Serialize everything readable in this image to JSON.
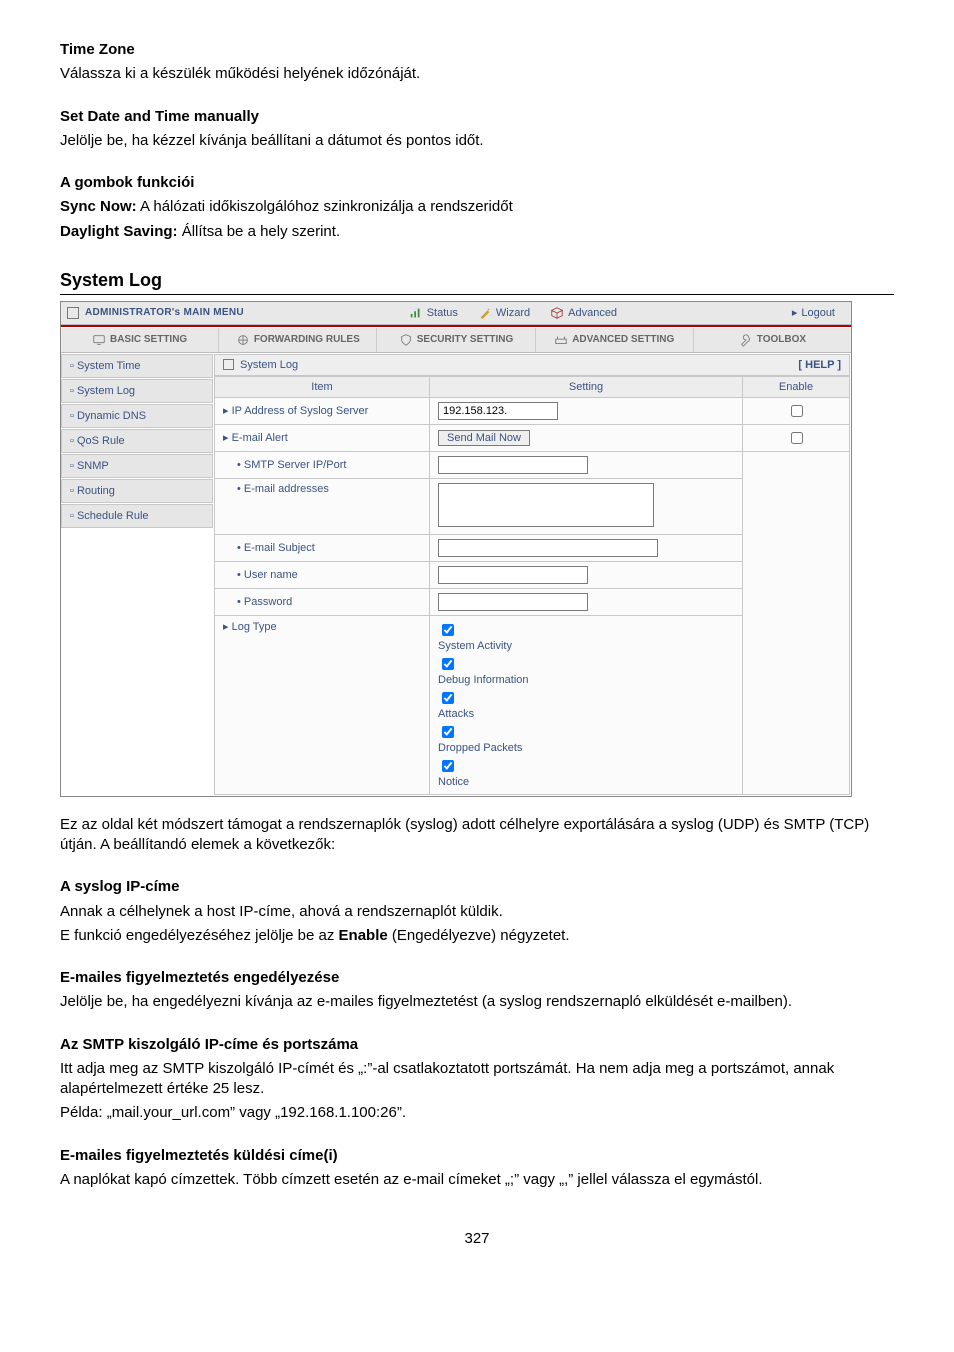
{
  "text": {
    "timezone_h": "Time Zone",
    "timezone_p": "Válassza ki a készülék működési helyének időzónáját.",
    "setdate_h": "Set Date and Time manually",
    "setdate_p": "Jelölje be, ha kézzel kívánja beállítani a dátumot és pontos időt.",
    "buttons_h": "A gombok funkciói",
    "syncnow_b": "Sync Now:",
    "syncnow_t": " A hálózati időkiszolgálóhoz szinkronizálja a rendszeridőt",
    "daylight_b": "Daylight Saving:",
    "daylight_t": " Állítsa be a hely szerint.",
    "syslog_h": "System Log",
    "after1": "Ez az oldal két módszert támogat a rendszernaplók (syslog) adott célhelyre exportálására a syslog (UDP) és SMTP (TCP) útján. A beállítandó elemek a következők:",
    "a1h": "A syslog IP-címe",
    "a1p1": "Annak a célhelynek a host IP-címe, ahová a rendszernaplót küldik.",
    "a1p2a": "E funkció engedélyezéséhez jelölje be az ",
    "a1p2b": "Enable",
    "a1p2c": " (Engedélyezve) négyzetet.",
    "a2h": "E-mailes figyelmeztetés engedélyezése",
    "a2p": "Jelölje be, ha engedélyezni kívánja az e-mailes figyelmeztetést (a syslog rendszernapló elküldését e-mailben).",
    "a3h": "Az SMTP kiszolgáló IP-címe és portszáma",
    "a3p1": "Itt adja meg az SMTP kiszolgáló IP-címét és „:”-al csatlakoztatott portszámát. Ha nem adja meg a portszámot, annak alapértelmezett értéke 25 lesz.",
    "a3p2": "Példa: „mail.your_url.com” vagy „192.168.1.100:26”.",
    "a4h": "E-mailes figyelmeztetés küldési címe(i)",
    "a4p": "A naplókat kapó címzettek. Több címzett esetén az e-mail címeket „;” vagy „,” jellel válassza el egymástól.",
    "pageno": "327"
  },
  "ui": {
    "mainmenu": "ADMINISTRATOR's MAIN MENU",
    "top_status": "Status",
    "top_wizard": "Wizard",
    "top_advanced": "Advanced",
    "top_logout": "Logout",
    "tab_basic": "BASIC SETTING",
    "tab_forward": "FORWARDING RULES",
    "tab_security": "SECURITY SETTING",
    "tab_advanced": "ADVANCED SETTING",
    "tab_toolbox": "TOOLBOX",
    "nav": {
      "n0": "System Time",
      "n1": "System Log",
      "n2": "Dynamic DNS",
      "n3": "QoS Rule",
      "n4": "SNMP",
      "n5": "Routing",
      "n6": "Schedule Rule"
    },
    "panel_title": "System Log",
    "help": "[ HELP ]",
    "col_item": "Item",
    "col_setting": "Setting",
    "col_enable": "Enable",
    "row_ip": "IP Address of Syslog Server",
    "row_ip_val": "192.158.123.",
    "row_email": "E-mail Alert",
    "row_email_btn": "Send Mail Now",
    "row_smtp": "SMTP Server IP/Port",
    "row_addr": "E-mail addresses",
    "row_subj": "E-mail Subject",
    "row_user": "User name",
    "row_pass": "Password",
    "row_logtype": "Log Type",
    "lt1": "System Activity",
    "lt2": "Debug Information",
    "lt3": "Attacks",
    "lt4": "Dropped Packets",
    "lt5": "Notice"
  }
}
